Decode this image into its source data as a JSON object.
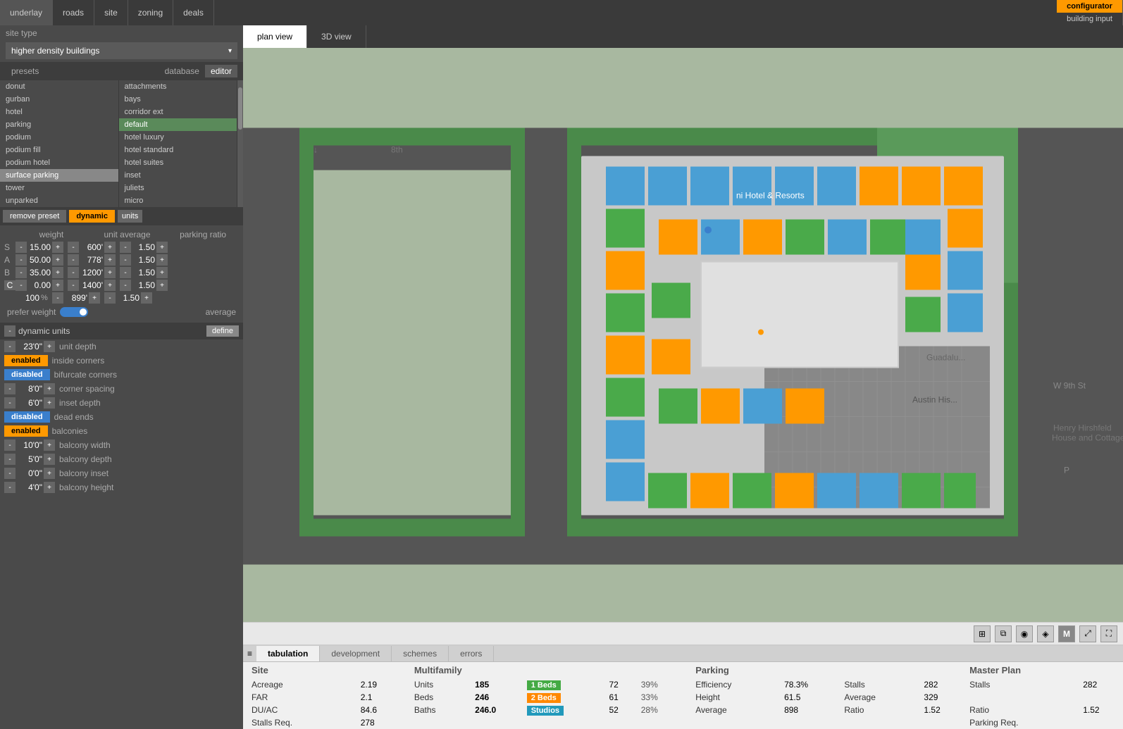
{
  "topnav": {
    "items": [
      "underlay",
      "roads",
      "site",
      "zoning",
      "deals"
    ],
    "active": "configurator",
    "sub": [
      "configurator",
      "building input"
    ]
  },
  "siteType": {
    "label": "site type",
    "value": "higher density buildings"
  },
  "presets": {
    "label": "presets",
    "tabs": [
      "database",
      "editor"
    ],
    "activeTab": "editor",
    "col1": [
      "donut",
      "gurban",
      "hotel",
      "parking",
      "podium",
      "podium fill",
      "podium hotel",
      "surface parking",
      "tower",
      "unparked"
    ],
    "col2": [
      "attachments",
      "bays",
      "corridor ext",
      "default",
      "hotel luxury",
      "hotel standard",
      "hotel suites",
      "inset",
      "juliets",
      "micro"
    ],
    "actions": {
      "removePreset": "remove preset",
      "dynamic": "dynamic",
      "units": "units"
    }
  },
  "weightTable": {
    "headers": [
      "weight",
      "unit average",
      "parking ratio"
    ],
    "rows": [
      {
        "label": "S",
        "weight": "15.00",
        "avg": "600'",
        "parking": "1.50"
      },
      {
        "label": "A",
        "weight": "50.00",
        "avg": "778'",
        "parking": "1.50"
      },
      {
        "label": "B",
        "weight": "35.00",
        "avg": "1200'",
        "parking": "1.50"
      },
      {
        "label": "C",
        "weight": "0.00",
        "avg": "1400'",
        "parking": "1.50"
      }
    ],
    "total": {
      "weight": "100",
      "pct": "%",
      "avg": "899'",
      "parking": "1.50"
    },
    "preferWeight": "prefer weight",
    "average": "average"
  },
  "dynamicUnits": {
    "title": "dynamic units",
    "define": "define",
    "rows": [
      {
        "type": "value",
        "minus": "-",
        "value": "23'0\"",
        "plus": "+",
        "label": "unit depth"
      },
      {
        "type": "toggle",
        "state": "enabled",
        "label": "inside corners"
      },
      {
        "type": "toggle",
        "state": "disabled",
        "label": "bifurcate corners"
      },
      {
        "type": "value",
        "minus": "-",
        "value": "8'0\"",
        "plus": "+",
        "label": "corner spacing"
      },
      {
        "type": "value",
        "minus": "-",
        "value": "6'0\"",
        "plus": "+",
        "label": "inset depth"
      },
      {
        "type": "toggle",
        "state": "disabled",
        "label": "dead ends"
      },
      {
        "type": "toggle",
        "state": "enabled",
        "label": "balconies"
      },
      {
        "type": "value",
        "minus": "-",
        "value": "10'0\"",
        "plus": "+",
        "label": "balcony width"
      },
      {
        "type": "value",
        "minus": "-",
        "value": "5'0\"",
        "plus": "+",
        "label": "balcony depth"
      },
      {
        "type": "value",
        "minus": "-",
        "value": "0'0\"",
        "plus": "+",
        "label": "balcony inset"
      },
      {
        "type": "value",
        "minus": "-",
        "value": "4'0\"",
        "plus": "+",
        "label": "balcony height"
      }
    ]
  },
  "mapTabs": {
    "tabs": [
      "plan view",
      "3D view"
    ],
    "active": "plan view"
  },
  "bottomTabs": {
    "tabs": [
      "tabulation",
      "development",
      "schemes",
      "errors"
    ],
    "active": "tabulation"
  },
  "dataTable": {
    "headers": {
      "site": "Site",
      "multifamily": "Multifamily",
      "parking": "Parking",
      "masterPlan": "Master Plan"
    },
    "rows": [
      {
        "siteLabel": "Acreage",
        "siteVal": "2.19",
        "mfLabel": "Units",
        "mfVal": "185",
        "badge1": "1 Beds",
        "badge1Color": "green",
        "badge1Num": "72",
        "badge1Pct": "39%",
        "parkLabel": "Efficiency",
        "parkVal": "78.3%",
        "parkLabel2": "Stalls",
        "parkVal2": "282",
        "mpLabel": "Stalls",
        "mpVal": "282"
      },
      {
        "siteLabel": "FAR",
        "siteVal": "2.1",
        "mfLabel": "Beds",
        "mfVal": "246",
        "badge1": "2 Beds",
        "badge1Color": "orange",
        "badge1Num": "61",
        "badge1Pct": "33%",
        "parkLabel": "Height",
        "parkVal": "61.5",
        "parkLabel2": "Average",
        "parkVal2": "329",
        "mpLabel": "",
        "mpVal": ""
      },
      {
        "siteLabel": "DU/AC",
        "siteVal": "84.6",
        "mfLabel": "Baths",
        "mfVal": "246.0",
        "badge1": "Studios",
        "badge1Color": "cyan",
        "badge1Num": "52",
        "badge1Pct": "28%",
        "parkLabel": "Average",
        "parkVal": "898",
        "parkLabel2": "Ratio",
        "parkVal2": "1.52",
        "mpLabel": "Ratio",
        "mpVal": "1.52"
      },
      {
        "siteLabel": "Stalls Req.",
        "siteVal": "278",
        "mfLabel": "",
        "mfVal": "",
        "badge1": "",
        "badge1Num": "",
        "badge1Pct": "",
        "parkLabel": "",
        "parkVal": "",
        "parkLabel2": "",
        "parkVal2": "",
        "mpLabel": "Parking Req.",
        "mpVal": ""
      }
    ]
  },
  "toolbar": {
    "icons": [
      "grid",
      "layers",
      "globe",
      "map-marker",
      "M",
      "expand",
      "fullscreen"
    ]
  }
}
